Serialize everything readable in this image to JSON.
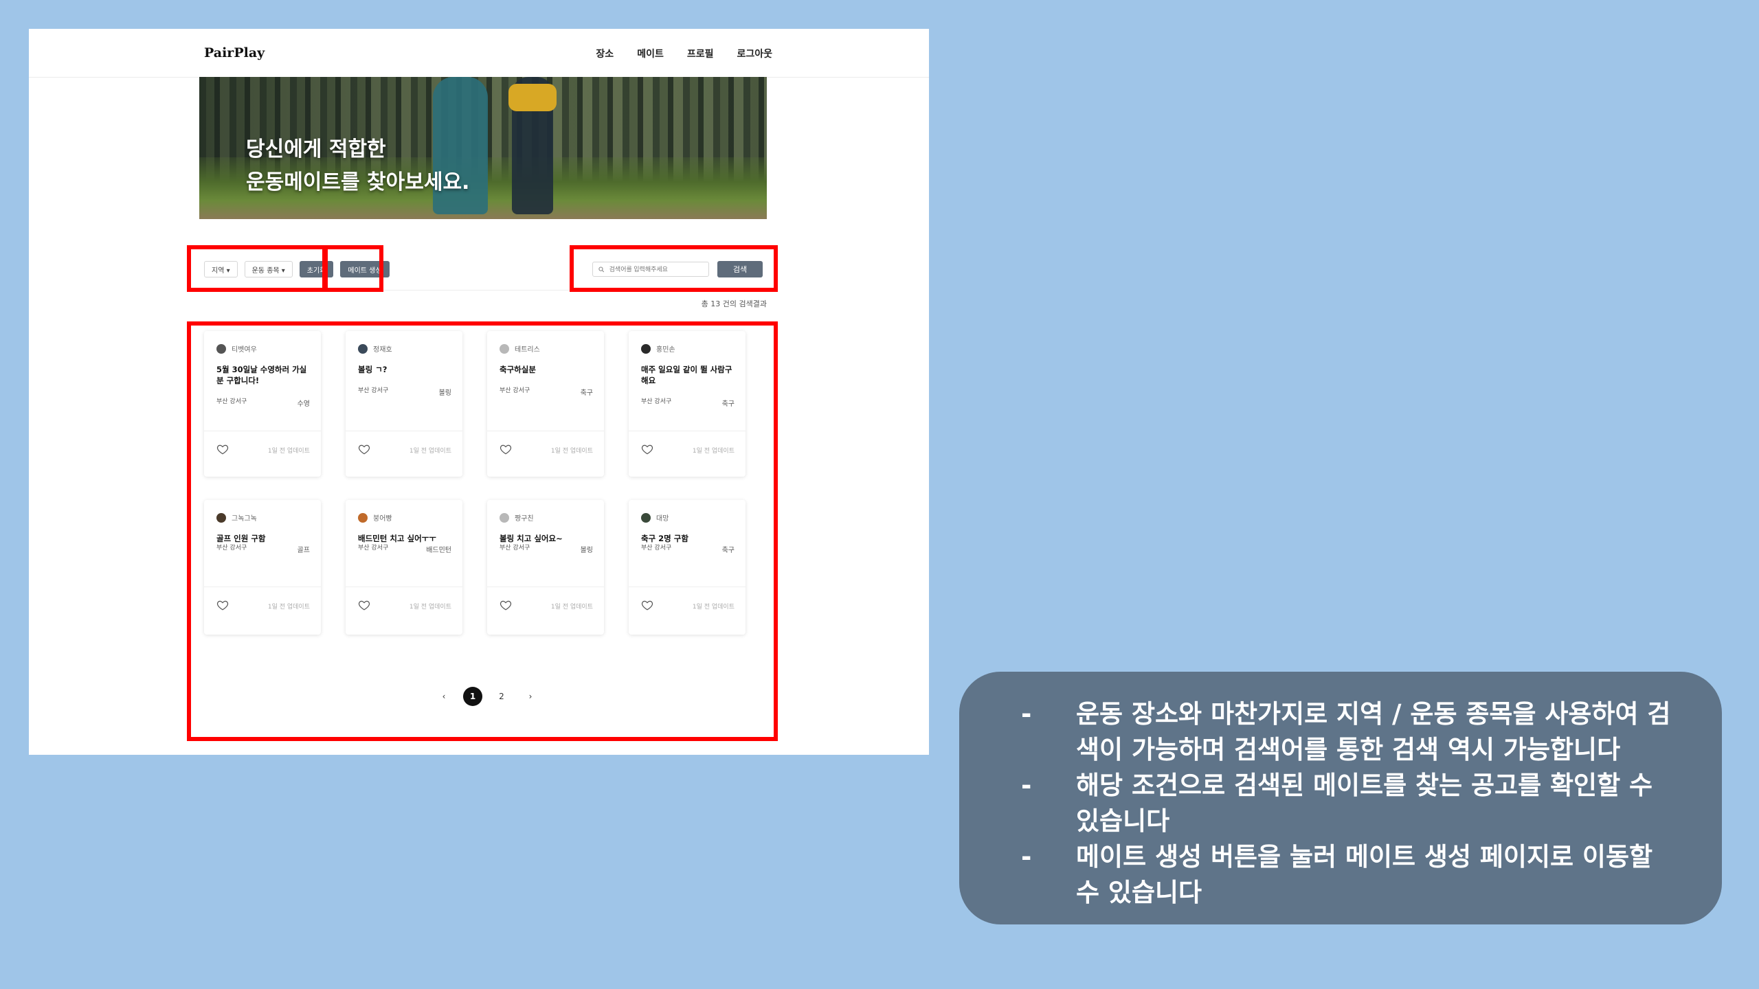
{
  "app": {
    "logo": "PairPlay",
    "nav": [
      "장소",
      "메이트",
      "프로필",
      "로그아웃"
    ]
  },
  "hero": {
    "line1": "당신에게 적합한",
    "line2": "운동메이트를 찾아보세요."
  },
  "filters": {
    "region": "지역 ▾",
    "sport": "운동 종목 ▾",
    "reset": "초기화",
    "create": "메이트 생성"
  },
  "search": {
    "placeholder": "검색어를 입력해주세요",
    "button": "검색",
    "result_text": "총 13 건의 검색결과"
  },
  "cards": [
    {
      "author": "티벳여우",
      "title": "5월 30일날 수영하러 가실 분 구합니다!",
      "location": "부산 강서구",
      "sport": "수영",
      "updated": "1일 전 업데이트",
      "avatar_color": "#555555"
    },
    {
      "author": "정재호",
      "title": "볼링 ㄱ?",
      "location": "부산 강서구",
      "sport": "볼링",
      "updated": "1일 전 업데이트",
      "avatar_color": "#3b4a5a"
    },
    {
      "author": "테트리스",
      "title": "축구하실분",
      "location": "부산 강서구",
      "sport": "축구",
      "updated": "1일 전 업데이트",
      "avatar_color": "#b8b8b8"
    },
    {
      "author": "홍민손",
      "title": "매주 일요일 같이 뛸 사람구해요",
      "location": "부산 강서구",
      "sport": "축구",
      "updated": "1일 전 업데이트",
      "avatar_color": "#2a2a2a"
    },
    {
      "author": "그녹그녹",
      "title": "골프 인원 구함",
      "location": "부산 강서구",
      "sport": "골프",
      "updated": "1일 전 업데이트",
      "avatar_color": "#4a3a2a"
    },
    {
      "author": "붕어빵",
      "title": "배드민턴 치고 싶어ㅜㅜ",
      "location": "부산 강서구",
      "sport": "배드민턴",
      "updated": "1일 전 업데이트",
      "avatar_color": "#c06a2a"
    },
    {
      "author": "짱구친",
      "title": "볼링 치고 싶어요~",
      "location": "부산 강서구",
      "sport": "볼링",
      "updated": "1일 전 업데이트",
      "avatar_color": "#b8b8b8"
    },
    {
      "author": "대망",
      "title": "축구 2명 구함",
      "location": "부산 강서구",
      "sport": "축구",
      "updated": "1일 전 업데이트",
      "avatar_color": "#3a4a3a"
    }
  ],
  "pagination": {
    "prev": "‹",
    "pages": [
      "1",
      "2"
    ],
    "next": "›",
    "current": "1"
  },
  "notes": {
    "items": [
      "운동 장소와 마찬가지로 지역 / 운동 종목을 사용하여 검색이 가능하며 검색어를 통한 검색 역시 가능합니다",
      "해당 조건으로 검색된 메이트를 찾는 공고를 확인할 수 있습니다",
      "메이트 생성 버튼을 눌러 메이트 생성 페이지로 이동할 수 있습니다"
    ],
    "bullet": "-"
  },
  "colors": {
    "background": "#9fc5e8",
    "highlight": "#ff0000",
    "note_bg": "#5f7489",
    "button_dark": "#5f6c7b"
  }
}
